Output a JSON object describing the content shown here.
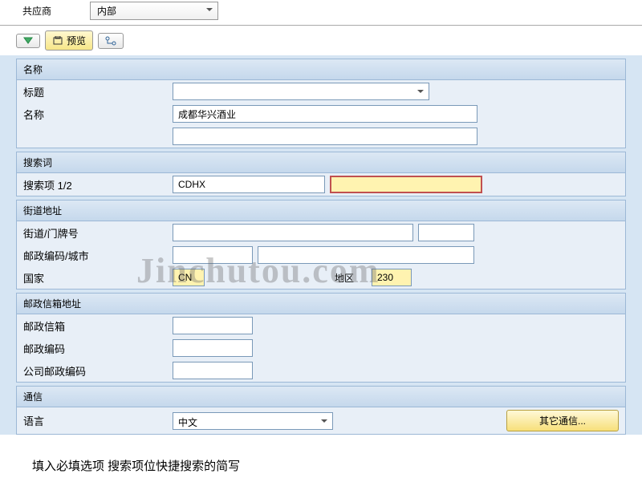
{
  "top": {
    "vendor_label": "共应商",
    "dept_value": "内部"
  },
  "toolbar": {
    "preview": "预览"
  },
  "watermark": "Jinchutou.com",
  "sections": {
    "name": {
      "title": "名称",
      "title_label": "标题",
      "title_value": "",
      "name_label": "名称",
      "name_value": "成都华兴酒业",
      "name_value2": ""
    },
    "search": {
      "title": "搜索词",
      "search_label": "搜索项 1/2",
      "search_value1": "CDHX",
      "search_value2": ""
    },
    "street": {
      "title": "街道地址",
      "street_label": "街道/门牌号",
      "street_value": "",
      "house_value": "",
      "postal_label": "邮政编码/城市",
      "postal_value": "",
      "city_value": "",
      "country_label": "国家",
      "country_value": "CN",
      "region_label": "地区",
      "region_value": "230"
    },
    "pobox": {
      "title": "邮政信箱地址",
      "pobox_label": "邮政信箱",
      "pobox_value": "",
      "postal_label": "邮政编码",
      "postal_value": "",
      "company_label": "公司邮政编码",
      "company_value": ""
    },
    "comm": {
      "title": "通信",
      "lang_label": "语言",
      "lang_value": "中文",
      "other_btn": "其它通信..."
    }
  },
  "footer": "填入必填选项 搜索项位快捷搜索的简写"
}
